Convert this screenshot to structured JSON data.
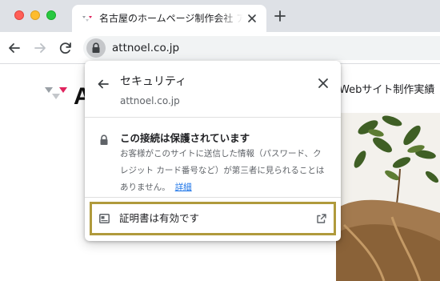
{
  "browser": {
    "tab": {
      "title": "名古屋のホームページ制作会社 アットノエル",
      "favicon": "site-favicon-icon"
    },
    "new_tab_icon": "plus-icon",
    "nav": {
      "back": "arrow-left-icon",
      "forward": "arrow-right-icon",
      "reload": "reload-icon"
    },
    "url": "attnoel.co.jp"
  },
  "page": {
    "logo_letter": "A",
    "nav_text": "Webサイト制作実績"
  },
  "popup": {
    "title": "セキュリティ",
    "domain": "attnoel.co.jp",
    "connection_heading": "この接続は保護されています",
    "connection_desc": "お客様がこのサイトに送信した情報（パスワード、クレジット カード番号など）が第三者に見られることはありません。",
    "details_link": "詳細",
    "certificate_label": "証明書は有効です"
  },
  "colors": {
    "tabstrip": "#dee1e6",
    "link": "#1a73e8",
    "highlight": "#b09a3c",
    "lock_chip": "#c5c7ca"
  }
}
